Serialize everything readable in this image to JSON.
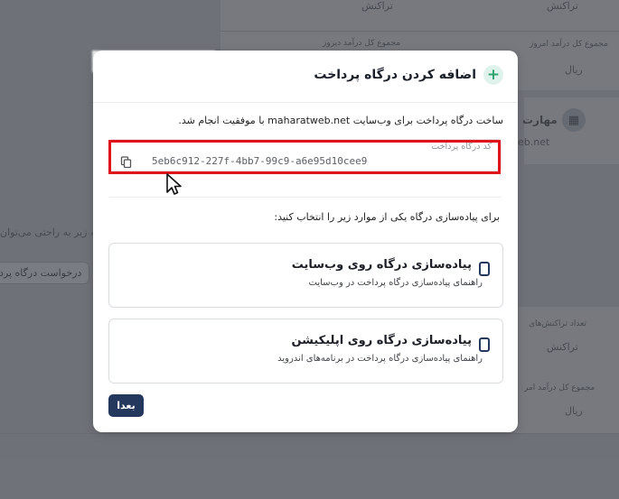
{
  "background": {
    "right_top_item": "تراکنش",
    "left_top_item": "تراکنش",
    "today_income_label": "مجموع کل درآمد امروز",
    "yesterday_income_label": "مجموع کل درآمد دیروز",
    "currency_1": "ریال",
    "site_name_partial": "مهارت",
    "site_url_partial": "eb.net",
    "intro_text_partial": "کمه زیر به راحتی می‌توان",
    "request_button_partial": "درخواست درگاه پرد",
    "transactions_count_label": "تعداد تراکنش‌های",
    "transactions_item": "تراکنش",
    "total_income_label": "مجموع کل درآمد امر",
    "currency_2": "ریال"
  },
  "modal": {
    "title": "اضافه کردن درگاه پرداخت",
    "success_message": "ساخت درگاه پرداخت برای وب‌سایت maharatweb.net با موفقیت انجام شد.",
    "code_field": {
      "label": "کد درگاه پرداخت",
      "value": "5eb6c912-227f-4bb7-99c9-a6e95d10cee9"
    },
    "choose_text": "برای پیاده‌سازی درگاه یکی از موارد زیر را انتخاب کنید:",
    "options": [
      {
        "title": "پیاده‌سازی درگاه روی وب‌سایت",
        "description": "راهنمای پیاده‌سازی درگاه پرداخت در وب‌سایت"
      },
      {
        "title": "پیاده‌سازی درگاه روی اپلیکیشن",
        "description": "راهنمای پیاده‌سازی درگاه پرداخت در برنامه‌های اندروید"
      }
    ],
    "next_button": "بعدا"
  },
  "colors": {
    "primary": "#24385e",
    "accent_green": "#31a36f",
    "highlight_red": "#e0131c"
  }
}
